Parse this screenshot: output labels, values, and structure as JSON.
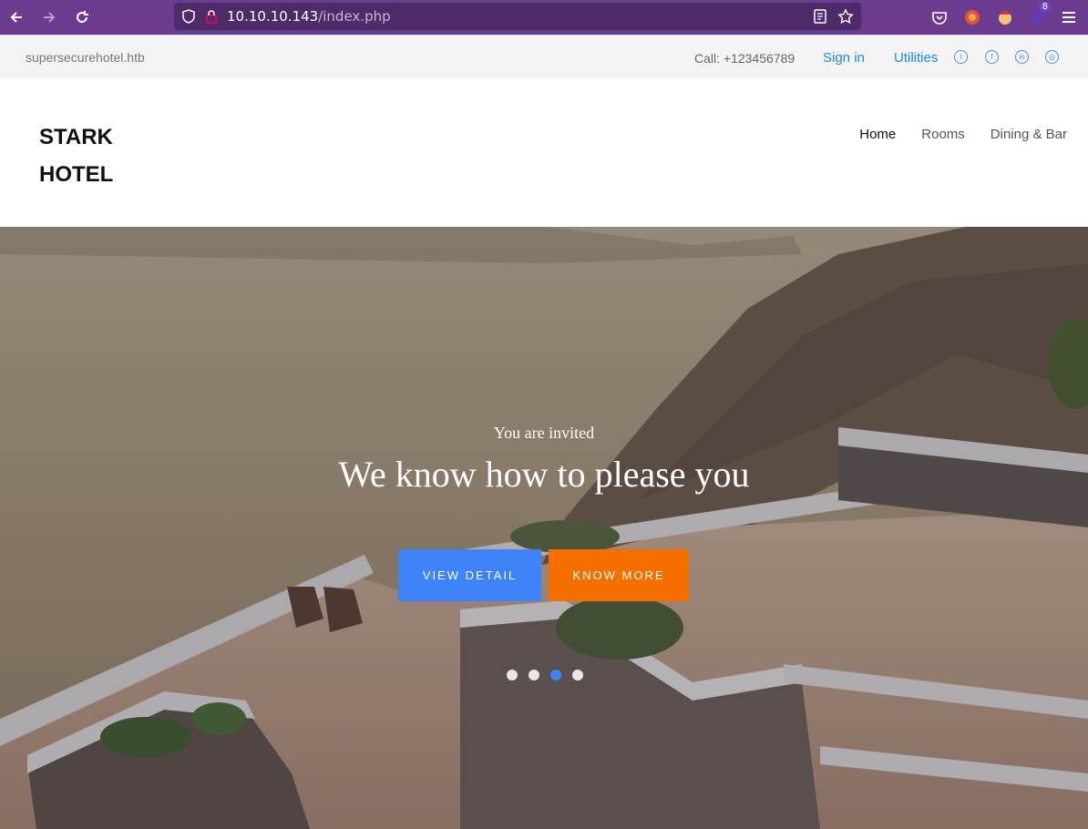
{
  "browser": {
    "url_host": "10.10.10.143",
    "url_path": "/index.php",
    "extension_badge": "8",
    "icons": [
      "back-icon",
      "forward-icon",
      "reload-icon",
      "shield-icon",
      "lock-icon",
      "reader-icon",
      "star-icon",
      "pocket-icon",
      "extension-icon",
      "menu-icon"
    ]
  },
  "topbar": {
    "domain": "supersecurehotel.htb",
    "call": "Call: +123456789",
    "signin": "Sign in",
    "utilities": "Utilities",
    "social_icons": [
      "twitter-icon",
      "facebook-icon",
      "linkedin-icon",
      "dribbble-icon"
    ]
  },
  "header": {
    "logo_line1": "STARK",
    "logo_line2": "HOTEL",
    "nav": [
      {
        "label": "Home",
        "active": true
      },
      {
        "label": "Rooms",
        "active": false
      },
      {
        "label": "Dining & Bar",
        "active": false
      }
    ]
  },
  "hero": {
    "subtitle": "You are invited",
    "title": "We know how to please you",
    "btn_detail": "VIEW DETAIL",
    "btn_more": "KNOW MORE",
    "slides": 4,
    "active_slide": 3
  },
  "colors": {
    "browser_bar": "#6a3b8f",
    "link": "#1e88e5",
    "btn_blue": "#3e83f8",
    "btn_orange": "#f36f00"
  }
}
